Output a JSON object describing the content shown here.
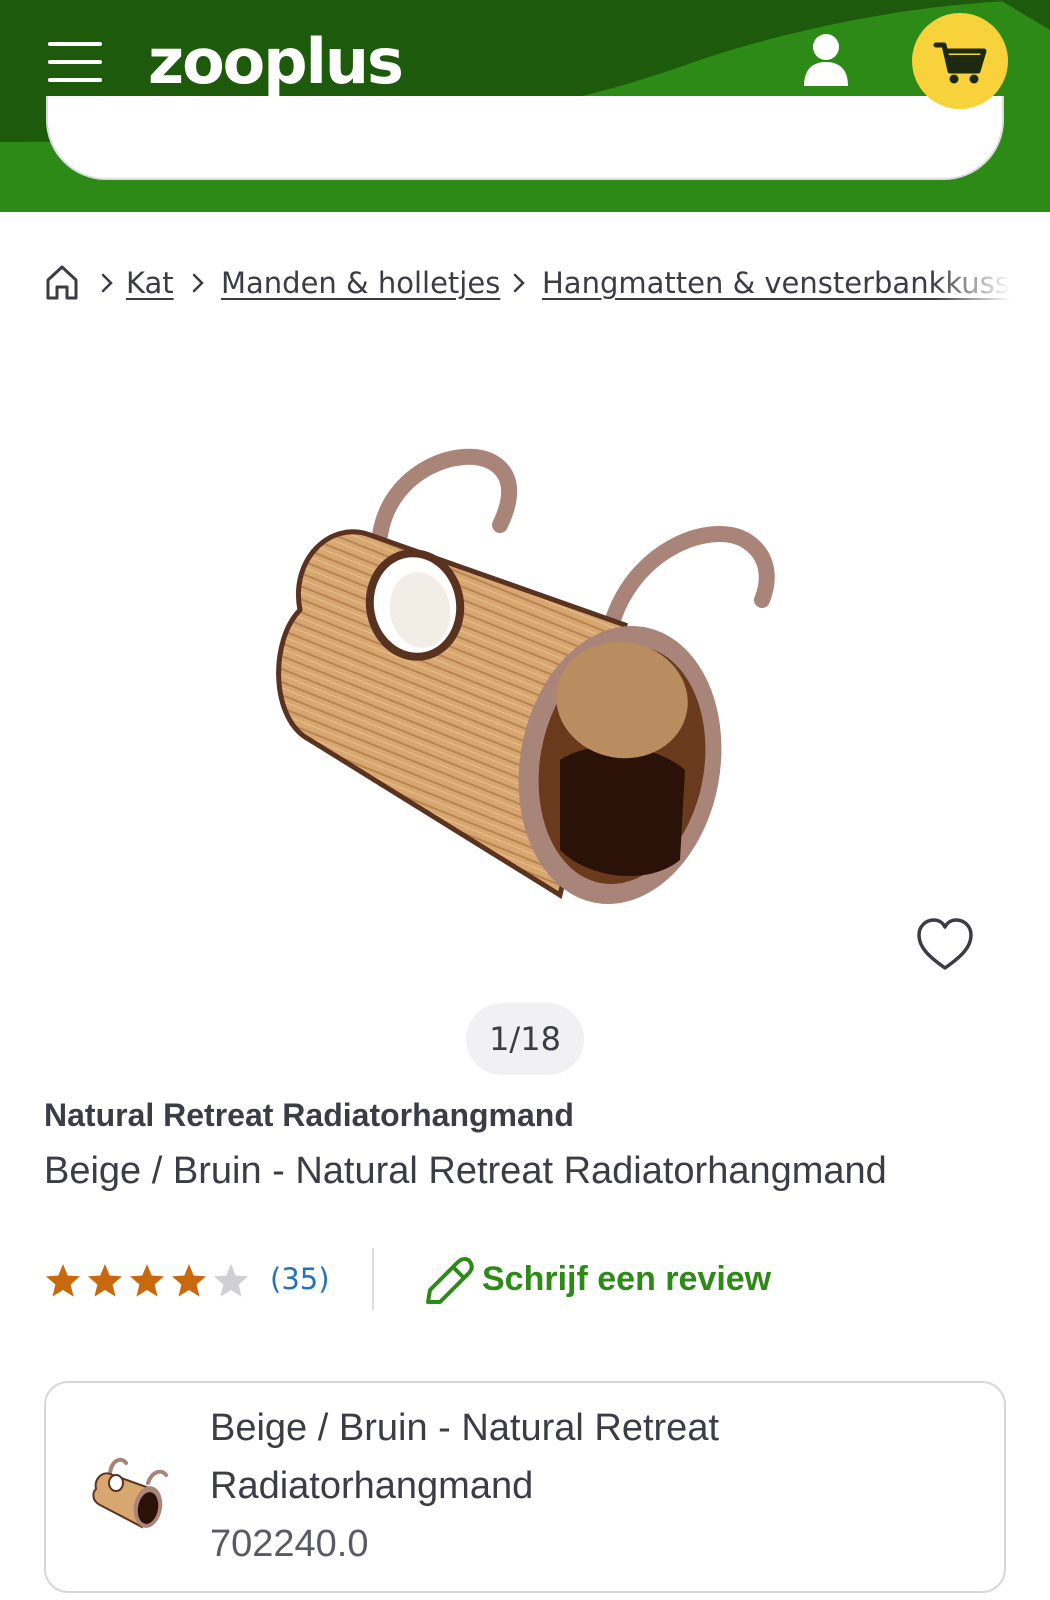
{
  "header": {
    "logo_text": "zooplus",
    "colors": {
      "dark_green": "#1e5a0c",
      "green": "#2e8a17",
      "cart_yellow": "#f8d23a"
    },
    "icons": [
      "menu-icon",
      "user-icon",
      "cart-icon"
    ]
  },
  "breadcrumb": {
    "home_icon": "home-icon",
    "items": [
      "Kat",
      "Manden & holletjes",
      "Hangmatten & vensterbankkussens"
    ]
  },
  "gallery": {
    "counter": "1/18",
    "favorite_icon": "heart-icon"
  },
  "product": {
    "title": "Natural Retreat Radiatorhangmand",
    "subtitle": "Beige / Bruin - Natural Retreat Radiatorhangmand",
    "rating": 4,
    "rating_max": 5,
    "review_count": "(35)",
    "write_review_label": "Schrijf een review",
    "rating_color": "#c8690d",
    "accent_link_color": "#2672b6"
  },
  "variant": {
    "name": "Beige / Bruin - Natural Retreat Radiatorhangmand",
    "code": "702240.0"
  }
}
